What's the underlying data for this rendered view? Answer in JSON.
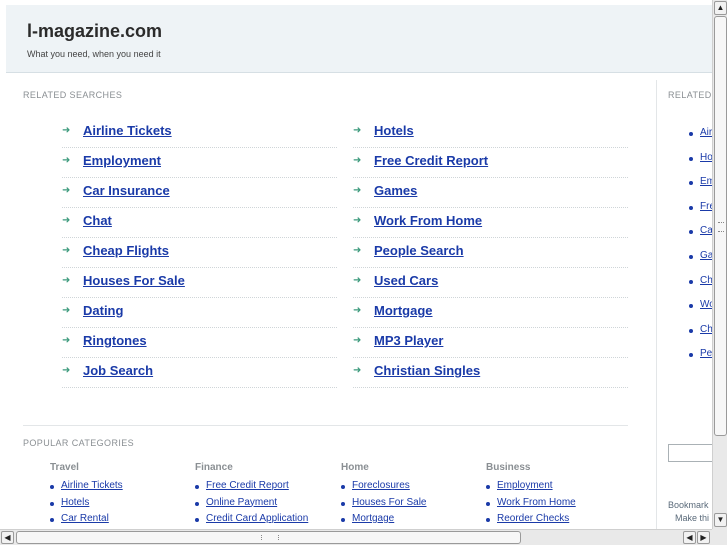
{
  "header": {
    "title": "l-magazine.com",
    "tagline": "What you need, when you need it"
  },
  "related_searches": {
    "label": "RELATED SEARCHES",
    "arrow_icon": "➜",
    "left": [
      "Airline Tickets",
      "Employment",
      "Car Insurance",
      "Chat",
      "Cheap Flights",
      "Houses For Sale",
      "Dating",
      "Ringtones",
      "Job Search"
    ],
    "right": [
      "Hotels",
      "Free Credit Report",
      "Games",
      "Work From Home",
      "People Search",
      "Used Cars",
      "Mortgage",
      "MP3 Player",
      "Christian Singles"
    ]
  },
  "popular_categories": {
    "label": "POPULAR CATEGORIES",
    "columns": [
      {
        "title": "Travel",
        "items": [
          "Airline Tickets",
          "Hotels",
          "Car Rental"
        ]
      },
      {
        "title": "Finance",
        "items": [
          "Free Credit Report",
          "Online Payment",
          "Credit Card Application"
        ]
      },
      {
        "title": "Home",
        "items": [
          "Foreclosures",
          "Houses For Sale",
          "Mortgage"
        ]
      },
      {
        "title": "Business",
        "items": [
          "Employment",
          "Work From Home",
          "Reorder Checks"
        ]
      }
    ]
  },
  "sidebar": {
    "label": "RELATED",
    "items": [
      "Air",
      "Ho",
      "Em",
      "Fre",
      "Ca",
      "Ga",
      "Ch",
      "Wo",
      "Ch",
      "Pe"
    ],
    "bookmark": "Bookmark",
    "make_this": "Make thi"
  },
  "scrollbars": {
    "up_icon": "▲",
    "down_icon": "▼",
    "left_icon": "◀",
    "right_icon": "▶"
  }
}
